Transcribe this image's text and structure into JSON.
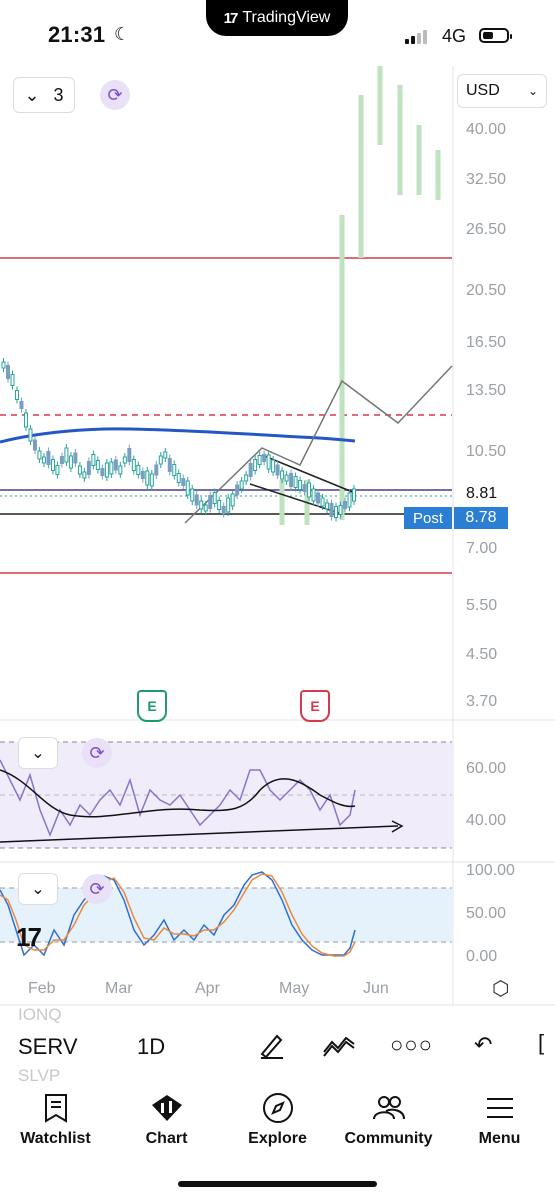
{
  "status": {
    "time": "21:31",
    "network": "4G"
  },
  "banner": {
    "brand": "TradingView"
  },
  "chart": {
    "currency": "USD",
    "interval_count": "3",
    "price_axis": [
      "40.00",
      "32.50",
      "26.50",
      "20.50",
      "16.50",
      "13.50",
      "10.50",
      "8.81",
      "7.00",
      "5.50",
      "4.50",
      "3.70"
    ],
    "last_price": "8.81",
    "post_label": "Post",
    "post_price": "8.78",
    "earnings_markers": [
      "E",
      "E"
    ],
    "x_axis": [
      "Feb",
      "Mar",
      "Apr",
      "May",
      "Jun"
    ],
    "rsi_axis": [
      "60.00",
      "40.00"
    ],
    "stoch_axis": [
      "100.00",
      "50.00",
      "0.00"
    ]
  },
  "toolbar": {
    "symbol": "SERV",
    "interval": "1D",
    "ghost_above": "IONQ",
    "ghost_below": "SLVP"
  },
  "nav": {
    "items": [
      {
        "label": "Watchlist",
        "icon": "watchlist-icon"
      },
      {
        "label": "Chart",
        "icon": "chart-icon"
      },
      {
        "label": "Explore",
        "icon": "compass-icon"
      },
      {
        "label": "Community",
        "icon": "community-icon"
      },
      {
        "label": "Menu",
        "icon": "menu-icon"
      }
    ]
  },
  "colors": {
    "bull": "#26a69a",
    "bear": "#7a9ec2",
    "red_line": "#d63a4a",
    "ma_blue": "#2457c5",
    "rsi": "#8a74c9",
    "post_blue": "#2a7fd4"
  }
}
